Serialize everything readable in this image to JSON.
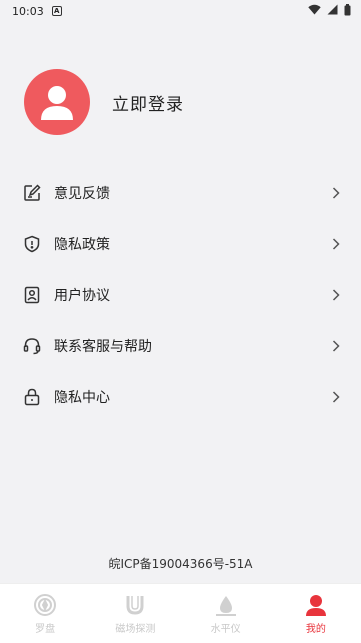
{
  "status_bar": {
    "time": "10:03",
    "notification_icon": "a-letter-icon",
    "icons": [
      "wifi-icon",
      "signal-icon",
      "battery-icon"
    ]
  },
  "profile": {
    "login_text": "立即登录",
    "avatar_color": "#ef5a5e"
  },
  "menu": {
    "items": [
      {
        "label": "意见反馈",
        "icon": "feedback-edit-icon"
      },
      {
        "label": "隐私政策",
        "icon": "shield-icon"
      },
      {
        "label": "用户协议",
        "icon": "user-agreement-icon"
      },
      {
        "label": "联系客服与帮助",
        "icon": "headset-icon"
      },
      {
        "label": "隐私中心",
        "icon": "lock-icon"
      }
    ]
  },
  "footer": {
    "icp": "皖ICP备19004366号-51A"
  },
  "bottom_nav": {
    "items": [
      {
        "label": "罗盘",
        "icon": "compass-icon",
        "active": false
      },
      {
        "label": "磁场探测",
        "icon": "magnet-icon",
        "active": false
      },
      {
        "label": "水平仪",
        "icon": "water-drop-icon",
        "active": false
      },
      {
        "label": "我的",
        "icon": "person-icon",
        "active": true
      }
    ],
    "active_color": "#e8343c",
    "inactive_color": "#c8c8c8"
  }
}
